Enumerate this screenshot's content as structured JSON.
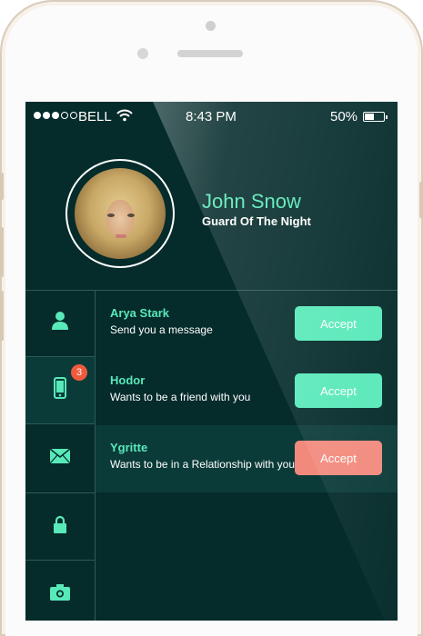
{
  "status_bar": {
    "carrier": "BELL",
    "time": "8:43 PM",
    "battery": "50%",
    "battery_level": 0.5,
    "signal_icon": "signal-dots-icon",
    "wifi_icon": "wifi-icon"
  },
  "profile": {
    "name": "John Snow",
    "subtitle": "Guard Of The Night"
  },
  "sidebar": {
    "items": [
      {
        "icon": "user-icon"
      },
      {
        "icon": "phone-icon",
        "badge": "3"
      },
      {
        "icon": "mail-icon"
      },
      {
        "icon": "lock-icon"
      },
      {
        "icon": "camera-icon"
      }
    ]
  },
  "requests": [
    {
      "name": "Arya Stark",
      "message": "Send you a message",
      "button": "Accept"
    },
    {
      "name": "Hodor",
      "message": "Wants to be a friend with you",
      "button": "Accept"
    },
    {
      "name": "Ygritte",
      "message": "Wants to be in a Relationship with you",
      "button": "Accept"
    }
  ],
  "colors": {
    "background": "#052b2b",
    "accent": "#58e9b9",
    "danger_button": "#f18a7d",
    "badge": "#f05a3c",
    "phone_body": "#f4ece0"
  }
}
